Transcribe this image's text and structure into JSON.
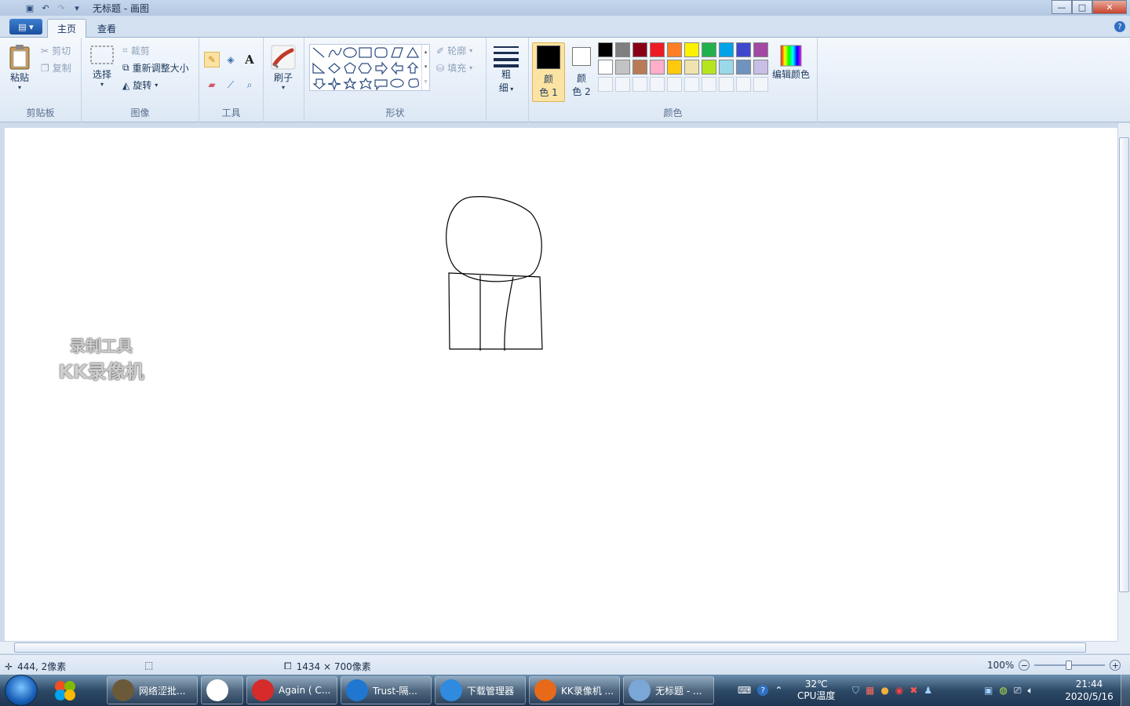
{
  "window": {
    "title": "无标题 - 画图",
    "buttons": {
      "minimize": "—",
      "maximize": "□",
      "close": "✕"
    }
  },
  "tabs": {
    "home": "主页",
    "view": "查看",
    "help": "?"
  },
  "ribbon": {
    "clipboard": {
      "label": "剪贴板",
      "paste": "粘贴",
      "cut": "剪切",
      "copy": "复制"
    },
    "image": {
      "label": "图像",
      "select": "选择",
      "crop": "裁剪",
      "resize": "重新调整大小",
      "rotate": "旋转"
    },
    "tools": {
      "label": "工具"
    },
    "brush": {
      "label": "刷子"
    },
    "shapes": {
      "label": "形状",
      "outline": "轮廓",
      "fill": "填充"
    },
    "size": {
      "line1": "粗",
      "line2": "细"
    },
    "colors": {
      "label": "颜色",
      "color1_a": "颜",
      "color1_b": "色 1",
      "color2_a": "颜",
      "color2_b": "色 2",
      "edit": "编辑颜色",
      "color1_value": "#000000",
      "color2_value": "#ffffff",
      "palette_row1": [
        "#000000",
        "#7f7f7f",
        "#880015",
        "#ed1c24",
        "#ff7f27",
        "#fff200",
        "#22b14c",
        "#00a2e8",
        "#3f48cc",
        "#a349a4"
      ],
      "palette_row2": [
        "#ffffff",
        "#c3c3c3",
        "#b97a57",
        "#ffaec9",
        "#ffc90e",
        "#efe4b0",
        "#b5e61d",
        "#99d9ea",
        "#7092be",
        "#c8bfe7"
      ]
    }
  },
  "watermark": {
    "line1": "录制工具",
    "line2": "KK录像机"
  },
  "status": {
    "cursor": "444, 2像素",
    "size": "1434 × 700像素",
    "zoom": "100%",
    "minus": "−",
    "plus": "+"
  },
  "taskbar": {
    "items": [
      {
        "label": "网络涩批...",
        "color": "#6b5a3a"
      },
      {
        "label": "",
        "color": "#ffffff"
      },
      {
        "label": "Again ( C...",
        "color": "#d52b2b"
      },
      {
        "label": "Trust-隔...",
        "color": "#1f77d0"
      },
      {
        "label": "下载管理器",
        "color": "#2f8ae0"
      },
      {
        "label": "KK录像机 ...",
        "color": "#e66a1a"
      },
      {
        "label": "无标题 - ...",
        "color": "#7aa7d6"
      }
    ],
    "temp_value": "32℃",
    "temp_label": "CPU温度",
    "time": "21:44",
    "date": "2020/5/16"
  }
}
